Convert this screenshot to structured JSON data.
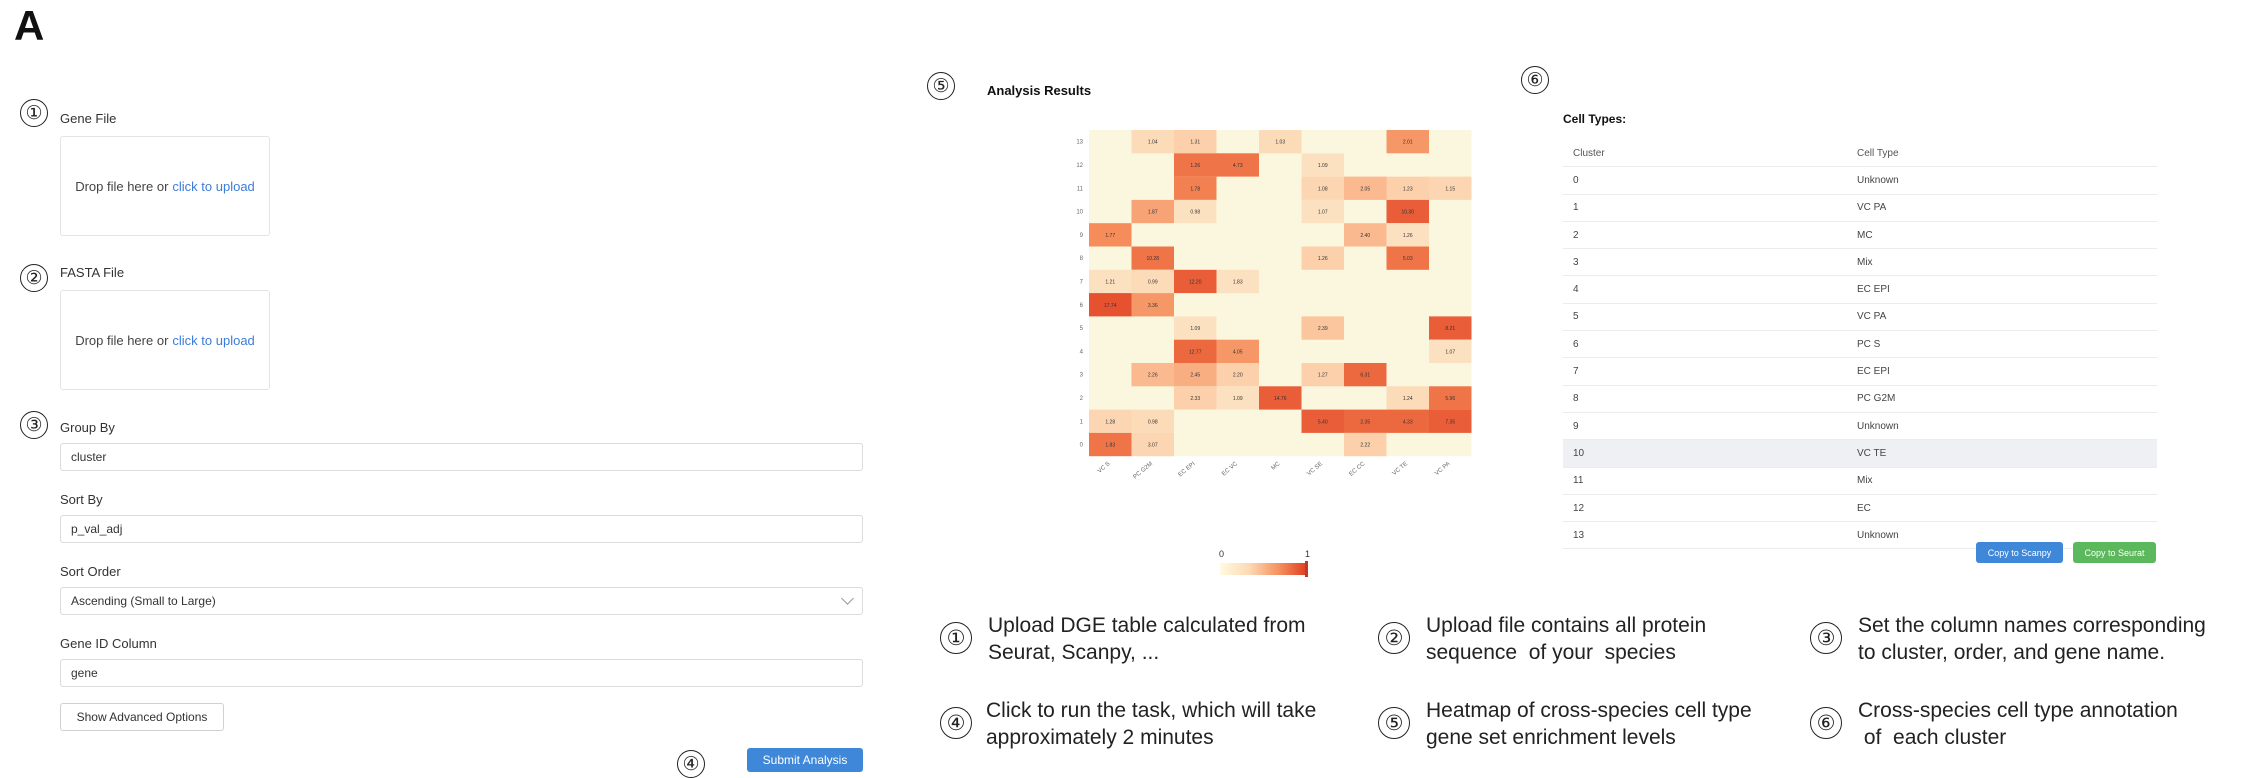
{
  "panel_letter": "A",
  "form": {
    "gene_file": {
      "num": "①",
      "label": "Gene File",
      "drop_text": "Drop file here or",
      "link_text": "click to upload"
    },
    "fasta_file": {
      "num": "②",
      "label": "FASTA File",
      "drop_text": "Drop file here or",
      "link_text": "click to upload"
    },
    "group_by": {
      "num": "③",
      "label": "Group By",
      "value": "cluster"
    },
    "sort_by": {
      "label": "Sort By",
      "value": "p_val_adj"
    },
    "sort_order": {
      "label": "Sort Order",
      "value": "Ascending (Small to Large)"
    },
    "gene_id": {
      "label": "Gene ID Column",
      "value": "gene"
    },
    "advanced_label": "Show Advanced Options",
    "submit": {
      "num": "④",
      "label": "Submit Analysis"
    }
  },
  "results": {
    "num": "⑤",
    "title": "Analysis Results",
    "legend_min": "0",
    "legend_max": "1"
  },
  "cell_types": {
    "num": "⑥",
    "title": "Cell Types:",
    "header": {
      "cluster": "Cluster",
      "type": "Cell Type"
    },
    "rows": [
      {
        "cluster": "0",
        "type": "Unknown"
      },
      {
        "cluster": "1",
        "type": "VC PA"
      },
      {
        "cluster": "2",
        "type": "MC"
      },
      {
        "cluster": "3",
        "type": "Mix"
      },
      {
        "cluster": "4",
        "type": "EC EPI"
      },
      {
        "cluster": "5",
        "type": "VC PA"
      },
      {
        "cluster": "6",
        "type": "PC S"
      },
      {
        "cluster": "7",
        "type": "EC EPI"
      },
      {
        "cluster": "8",
        "type": "PC G2M"
      },
      {
        "cluster": "9",
        "type": "Unknown"
      },
      {
        "cluster": "10",
        "type": "VC TE"
      },
      {
        "cluster": "11",
        "type": "Mix"
      },
      {
        "cluster": "12",
        "type": "EC"
      },
      {
        "cluster": "13",
        "type": "Unknown"
      }
    ],
    "copy_scanpy": "Copy to Scanpy",
    "copy_seurat": "Copy to Seurat"
  },
  "descriptions": [
    {
      "num": "①",
      "text": "Upload DGE table calculated from\nSeurat, Scanpy, ..."
    },
    {
      "num": "②",
      "text": "Upload file contains all protein\nsequence  of your  species"
    },
    {
      "num": "③",
      "text": "Set the column names corresponding\nto cluster, order, and gene name."
    },
    {
      "num": "④",
      "text": "Click to run the task, which will take\napproximately 2 minutes"
    },
    {
      "num": "⑤",
      "text": "Heatmap of cross-species cell type\ngene set enrichment levels"
    },
    {
      "num": "⑥",
      "text": "Cross-species cell type annotation\n of  each cluster"
    }
  ],
  "chart_data": {
    "type": "heatmap",
    "rows": [
      "13",
      "12",
      "11",
      "10",
      "9",
      "8",
      "7",
      "6",
      "5",
      "4",
      "3",
      "2",
      "1",
      "0"
    ],
    "cols": [
      "VC S",
      "PC G2M",
      "EC EPI",
      "EC VC",
      "MC",
      "VC SE",
      "EC CC",
      "VC TE",
      "VC PA"
    ],
    "scale": [
      0,
      1
    ],
    "cells": [
      {
        "r": 0,
        "c": 1,
        "v": 0.25,
        "label": "1.04"
      },
      {
        "r": 0,
        "c": 2,
        "v": 0.35,
        "label": "1.31"
      },
      {
        "r": 0,
        "c": 4,
        "v": 0.25,
        "label": "1.03"
      },
      {
        "r": 0,
        "c": 7,
        "v": 0.6,
        "label": "2.01"
      },
      {
        "r": 1,
        "c": 2,
        "v": 0.75,
        "label": "1.26"
      },
      {
        "r": 1,
        "c": 3,
        "v": 0.75,
        "label": "4.73"
      },
      {
        "r": 1,
        "c": 5,
        "v": 0.2,
        "label": "1.09"
      },
      {
        "r": 2,
        "c": 2,
        "v": 0.7,
        "label": "1.78"
      },
      {
        "r": 2,
        "c": 5,
        "v": 0.3,
        "label": "1.08"
      },
      {
        "r": 2,
        "c": 6,
        "v": 0.45,
        "label": "2.05"
      },
      {
        "r": 2,
        "c": 7,
        "v": 0.35,
        "label": "1.23"
      },
      {
        "r": 2,
        "c": 8,
        "v": 0.3,
        "label": "1.15"
      },
      {
        "r": 3,
        "c": 1,
        "v": 0.55,
        "label": "1.87"
      },
      {
        "r": 3,
        "c": 2,
        "v": 0.2,
        "label": "0.98"
      },
      {
        "r": 3,
        "c": 5,
        "v": 0.2,
        "label": "1.07"
      },
      {
        "r": 3,
        "c": 7,
        "v": 0.85,
        "label": "10.30"
      },
      {
        "r": 4,
        "c": 0,
        "v": 0.65,
        "label": "1.77"
      },
      {
        "r": 4,
        "c": 6,
        "v": 0.45,
        "label": "2.40"
      },
      {
        "r": 4,
        "c": 7,
        "v": 0.2,
        "label": "1.26"
      },
      {
        "r": 5,
        "c": 1,
        "v": 0.75,
        "label": "10.28"
      },
      {
        "r": 5,
        "c": 5,
        "v": 0.35,
        "label": "1.26"
      },
      {
        "r": 5,
        "c": 7,
        "v": 0.75,
        "label": "5.03"
      },
      {
        "r": 6,
        "c": 0,
        "v": 0.2,
        "label": "1.21"
      },
      {
        "r": 6,
        "c": 1,
        "v": 0.25,
        "label": "0.99"
      },
      {
        "r": 6,
        "c": 2,
        "v": 0.85,
        "label": "12.20"
      },
      {
        "r": 6,
        "c": 3,
        "v": 0.2,
        "label": "1.83"
      },
      {
        "r": 7,
        "c": 0,
        "v": 0.9,
        "label": "17.74"
      },
      {
        "r": 7,
        "c": 1,
        "v": 0.6,
        "label": "3.36"
      },
      {
        "r": 8,
        "c": 2,
        "v": 0.2,
        "label": "1.09"
      },
      {
        "r": 8,
        "c": 5,
        "v": 0.4,
        "label": "2.39"
      },
      {
        "r": 8,
        "c": 8,
        "v": 0.85,
        "label": "8.21"
      },
      {
        "r": 9,
        "c": 2,
        "v": 0.8,
        "label": "12.77"
      },
      {
        "r": 9,
        "c": 3,
        "v": 0.6,
        "label": "4.05"
      },
      {
        "r": 9,
        "c": 8,
        "v": 0.2,
        "label": "1.07"
      },
      {
        "r": 10,
        "c": 1,
        "v": 0.45,
        "label": "2.26"
      },
      {
        "r": 10,
        "c": 2,
        "v": 0.5,
        "label": "2.45"
      },
      {
        "r": 10,
        "c": 3,
        "v": 0.35,
        "label": "2.20"
      },
      {
        "r": 10,
        "c": 5,
        "v": 0.35,
        "label": "1.27"
      },
      {
        "r": 10,
        "c": 6,
        "v": 0.8,
        "label": "6.31"
      },
      {
        "r": 11,
        "c": 2,
        "v": 0.35,
        "label": "2.33"
      },
      {
        "r": 11,
        "c": 3,
        "v": 0.2,
        "label": "1.09"
      },
      {
        "r": 11,
        "c": 4,
        "v": 0.85,
        "label": "14.76"
      },
      {
        "r": 11,
        "c": 7,
        "v": 0.25,
        "label": "1.24"
      },
      {
        "r": 11,
        "c": 8,
        "v": 0.75,
        "label": "5.96"
      },
      {
        "r": 12,
        "c": 0,
        "v": 0.3,
        "label": "1.28"
      },
      {
        "r": 12,
        "c": 1,
        "v": 0.25,
        "label": "0.98"
      },
      {
        "r": 12,
        "c": 5,
        "v": 0.85,
        "label": "5.40"
      },
      {
        "r": 12,
        "c": 6,
        "v": 0.8,
        "label": "2.35"
      },
      {
        "r": 12,
        "c": 7,
        "v": 0.8,
        "label": "4.33"
      },
      {
        "r": 12,
        "c": 8,
        "v": 0.85,
        "label": "7.35"
      },
      {
        "r": 13,
        "c": 0,
        "v": 0.75,
        "label": "1.83"
      },
      {
        "r": 13,
        "c": 1,
        "v": 0.3,
        "label": "3.07"
      },
      {
        "r": 13,
        "c": 6,
        "v": 0.35,
        "label": "2.22"
      }
    ]
  }
}
